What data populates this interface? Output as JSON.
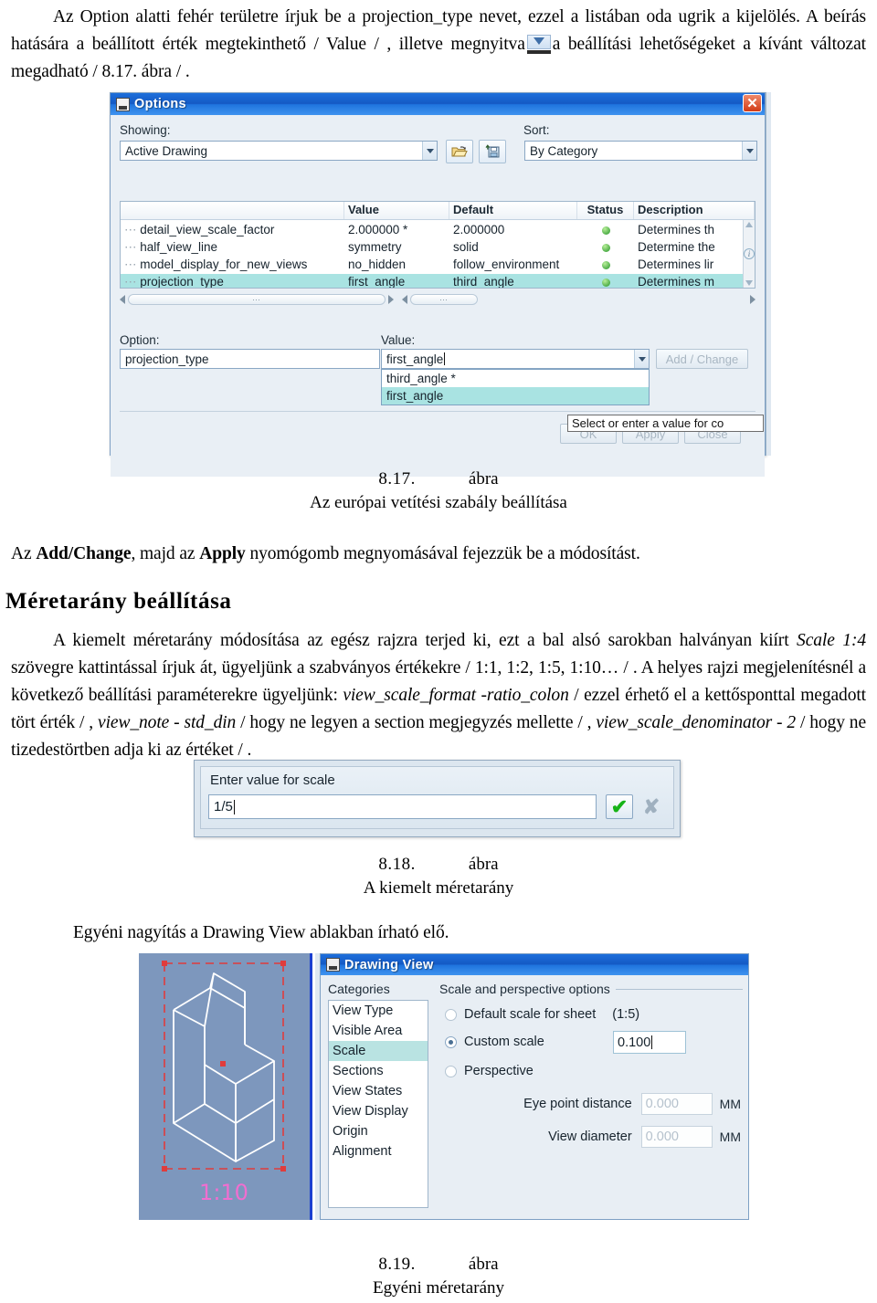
{
  "document": {
    "paragraph1": {
      "part1": "Az Option alatti fehér területre írjuk be a projection_type nevet, ezzel a listában oda ugrik a kijelölés. A beírás hatására a beállított érték megtekinthető / Value / , illetve megnyitva",
      "part2": "a beállítási lehetőségeket a kívánt változat megadható / 8.17. ábra / ."
    },
    "figure_817": {
      "number": "8.17.",
      "word": "ábra",
      "title": "Az európai vetítési szabály beállítása"
    },
    "paragraph2": {
      "pre": "Az ",
      "bold1": "Add/Change",
      "mid": ", majd az ",
      "bold2": "Apply",
      "post": " nyomógomb megnyomásával fejezzük be a módosítást."
    },
    "heading1": "Méretarány beállítása",
    "paragraph3": {
      "s1": "A kiemelt méretarány módosítása az egész rajzra terjed ki, ezt a bal alsó sarokban halványan kiírt ",
      "i1": "Scale 1:4",
      "s2": " szövegre kattintással írjuk át, ügyeljünk a szabványos értékekre / 1:1, 1:2, 1:5, 1:10… / . A helyes rajzi megjelenítésnél a következő beállítási paraméterekre ügyeljünk: ",
      "i2": "view_scale_format -ratio_colon",
      "s3": " / ezzel érhető el a kettősponttal megadott tört érték / , ",
      "i3": "view_note - std_din",
      "s4": " / hogy ne legyen a section megjegyzés mellette / , ",
      "i4": "view_scale_denominator - 2",
      "s5": " / hogy ne tizedestörtben adja ki az értéket / ."
    },
    "figure_818": {
      "number": "8.18.",
      "word": "ábra",
      "title": "A kiemelt méretarány"
    },
    "paragraph4": "Egyéni nagyítás a Drawing View ablakban írható elő.",
    "figure_819": {
      "number": "8.19.",
      "word": "ábra",
      "title": "Egyéni méretarány"
    }
  },
  "options_dialog": {
    "title": "Options",
    "close_label": "✕",
    "showing_label": "Showing:",
    "showing_value": "Active Drawing",
    "sort_label": "Sort:",
    "sort_value": "By Category",
    "open_button_tip": "open-config",
    "save_button_tip": "save-config",
    "grid": {
      "headers": [
        "",
        "Value",
        "Default",
        "Status",
        "Description"
      ],
      "rows": [
        {
          "name": "detail_view_scale_factor",
          "value": "2.000000 *",
          "default": "2.000000",
          "status": "●",
          "description": "Determines th",
          "selected": false
        },
        {
          "name": "half_view_line",
          "value": "symmetry",
          "default": "solid",
          "status": "●",
          "description": "Determine the",
          "selected": false
        },
        {
          "name": "model_display_for_new_views",
          "value": "no_hidden",
          "default": "follow_environment",
          "status": "●",
          "description": "Determines lir",
          "selected": false
        },
        {
          "name": "projection_type",
          "value": "first_angle",
          "default": "third_angle",
          "status": "●",
          "description": "Determines m",
          "selected": true
        }
      ]
    },
    "option_label": "Option:",
    "option_value": "projection_type",
    "value_label": "Value:",
    "value_value": "first_angle",
    "dropdown_options": [
      "third_angle *",
      "first_angle"
    ],
    "dropdown_selected_index": 1,
    "add_change_label": "Add / Change",
    "ok_label": "OK",
    "apply_label": "Apply",
    "close_btn_label": "Close",
    "tooltip": "Select or enter a value for co"
  },
  "scale_dialog": {
    "prompt": "Enter value for scale",
    "value": "1/5",
    "accept_label": "✔",
    "cancel_label": "✘"
  },
  "drawing_view_dialog": {
    "title": "Drawing View",
    "categories_label": "Categories",
    "categories": [
      "View Type",
      "Visible Area",
      "Scale",
      "Sections",
      "View States",
      "View Display",
      "Origin",
      "Alignment"
    ],
    "selected_category": "Scale",
    "group_title": "Scale and perspective options",
    "default_scale_label": "Default scale for sheet",
    "default_scale_value": "(1:5)",
    "custom_scale_label": "Custom scale",
    "custom_scale_value": "0.100",
    "perspective_label": "Perspective",
    "eye_point_label": "Eye point distance",
    "eye_point_value": "0.000",
    "eye_point_unit": "MM",
    "view_diameter_label": "View diameter",
    "view_diameter_value": "0.000",
    "view_diameter_unit": "MM",
    "selected_radio": "custom_scale"
  },
  "preview": {
    "scale_text": "1:10"
  },
  "colors": {
    "titlebar_blue": "#1459c4",
    "selection_cyan": "#a9e3e2",
    "status_green": "#4fae49",
    "preview_bg": "#7d97bd",
    "preview_annotation": "#e03c3c",
    "preview_scale_text": "#f06ed0"
  }
}
